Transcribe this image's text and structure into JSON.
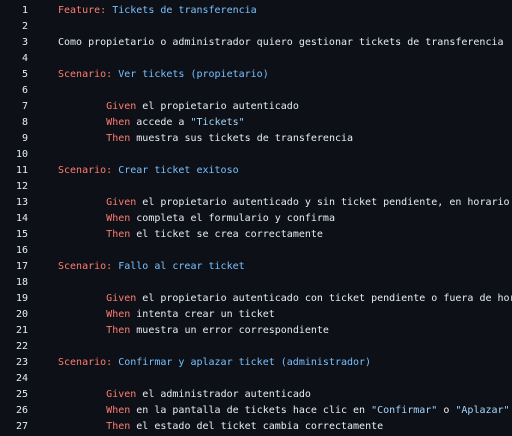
{
  "lines": [
    {
      "n": "1",
      "tokens": [
        {
          "t": "kw",
          "v": "Feature:"
        },
        {
          "t": "ttl",
          "v": " Tickets de transferencia"
        }
      ]
    },
    {
      "n": "2",
      "tokens": []
    },
    {
      "n": "3",
      "tokens": [
        {
          "t": "txt",
          "v": "Como propietario o administrador quiero gestionar tickets de transferencia"
        }
      ]
    },
    {
      "n": "4",
      "tokens": []
    },
    {
      "n": "5",
      "tokens": [
        {
          "t": "kw",
          "v": "Scenario:"
        },
        {
          "t": "ttl",
          "v": " Ver tickets (propietario)"
        }
      ]
    },
    {
      "n": "6",
      "tokens": []
    },
    {
      "n": "7",
      "tokens": [
        {
          "t": "txt",
          "v": "        "
        },
        {
          "t": "kw",
          "v": "Given"
        },
        {
          "t": "txt",
          "v": " el propietario autenticado"
        }
      ]
    },
    {
      "n": "8",
      "tokens": [
        {
          "t": "txt",
          "v": "        "
        },
        {
          "t": "kw",
          "v": "When"
        },
        {
          "t": "txt",
          "v": " accede a "
        },
        {
          "t": "str",
          "v": "\"Tickets\""
        }
      ]
    },
    {
      "n": "9",
      "tokens": [
        {
          "t": "txt",
          "v": "        "
        },
        {
          "t": "kw",
          "v": "Then"
        },
        {
          "t": "txt",
          "v": " muestra sus tickets de transferencia"
        }
      ]
    },
    {
      "n": "10",
      "tokens": []
    },
    {
      "n": "11",
      "tokens": [
        {
          "t": "kw",
          "v": "Scenario:"
        },
        {
          "t": "ttl",
          "v": " Crear ticket exitoso"
        }
      ]
    },
    {
      "n": "12",
      "tokens": []
    },
    {
      "n": "13",
      "tokens": [
        {
          "t": "txt",
          "v": "        "
        },
        {
          "t": "kw",
          "v": "Given"
        },
        {
          "t": "txt",
          "v": " el propietario autenticado y sin ticket pendiente, en horario permitido"
        }
      ]
    },
    {
      "n": "14",
      "tokens": [
        {
          "t": "txt",
          "v": "        "
        },
        {
          "t": "kw",
          "v": "When"
        },
        {
          "t": "txt",
          "v": " completa el formulario y confirma"
        }
      ]
    },
    {
      "n": "15",
      "tokens": [
        {
          "t": "txt",
          "v": "        "
        },
        {
          "t": "kw",
          "v": "Then"
        },
        {
          "t": "txt",
          "v": " el ticket se crea correctamente"
        }
      ]
    },
    {
      "n": "16",
      "tokens": []
    },
    {
      "n": "17",
      "tokens": [
        {
          "t": "kw",
          "v": "Scenario:"
        },
        {
          "t": "ttl",
          "v": " Fallo al crear ticket"
        }
      ]
    },
    {
      "n": "18",
      "tokens": []
    },
    {
      "n": "19",
      "tokens": [
        {
          "t": "txt",
          "v": "        "
        },
        {
          "t": "kw",
          "v": "Given"
        },
        {
          "t": "txt",
          "v": " el propietario autenticado con ticket pendiente o fuera de horario"
        }
      ]
    },
    {
      "n": "20",
      "tokens": [
        {
          "t": "txt",
          "v": "        "
        },
        {
          "t": "kw",
          "v": "When"
        },
        {
          "t": "txt",
          "v": " intenta crear un ticket"
        }
      ]
    },
    {
      "n": "21",
      "tokens": [
        {
          "t": "txt",
          "v": "        "
        },
        {
          "t": "kw",
          "v": "Then"
        },
        {
          "t": "txt",
          "v": " muestra un error correspondiente"
        }
      ]
    },
    {
      "n": "22",
      "tokens": []
    },
    {
      "n": "23",
      "tokens": [
        {
          "t": "kw",
          "v": "Scenario:"
        },
        {
          "t": "ttl",
          "v": " Confirmar y aplazar ticket (administrador)"
        }
      ]
    },
    {
      "n": "24",
      "tokens": []
    },
    {
      "n": "25",
      "tokens": [
        {
          "t": "txt",
          "v": "        "
        },
        {
          "t": "kw",
          "v": "Given"
        },
        {
          "t": "txt",
          "v": " el administrador autenticado"
        }
      ]
    },
    {
      "n": "26",
      "tokens": [
        {
          "t": "txt",
          "v": "        "
        },
        {
          "t": "kw",
          "v": "When"
        },
        {
          "t": "txt",
          "v": " en la pantalla de tickets hace clic en "
        },
        {
          "t": "str",
          "v": "\"Confirmar\""
        },
        {
          "t": "txt",
          "v": " o "
        },
        {
          "t": "str",
          "v": "\"Aplazar\""
        }
      ]
    },
    {
      "n": "27",
      "tokens": [
        {
          "t": "txt",
          "v": "        "
        },
        {
          "t": "kw",
          "v": "Then"
        },
        {
          "t": "txt",
          "v": " el estado del ticket cambia correctamente"
        }
      ]
    }
  ],
  "colors": {
    "background": "#0d1117",
    "keyword": "#ff7b72",
    "title": "#79c0ff",
    "string": "#a5d6ff",
    "text": "#e6edf3",
    "line_number": "#e6edf3"
  }
}
